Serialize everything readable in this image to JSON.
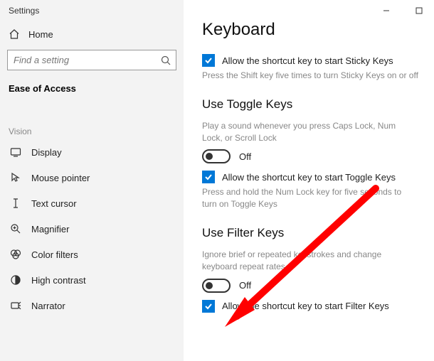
{
  "app": {
    "title": "Settings"
  },
  "sidebar": {
    "home_label": "Home",
    "search_placeholder": "Find a setting",
    "active_section": "Ease of Access",
    "group_head": "Vision",
    "items": [
      {
        "label": "Display"
      },
      {
        "label": "Mouse pointer"
      },
      {
        "label": "Text cursor"
      },
      {
        "label": "Magnifier"
      },
      {
        "label": "Color filters"
      },
      {
        "label": "High contrast"
      },
      {
        "label": "Narrator"
      }
    ]
  },
  "main": {
    "page_title": "Keyboard",
    "sticky": {
      "checkbox_label": "Allow the shortcut key to start Sticky Keys",
      "desc": "Press the Shift key five times to turn Sticky Keys on or off"
    },
    "toggle_section": {
      "heading": "Use Toggle Keys",
      "desc": "Play a sound whenever you press Caps Lock, Num Lock, or Scroll Lock",
      "toggle_state": "Off",
      "checkbox_label": "Allow the shortcut key to start Toggle Keys",
      "desc2": "Press and hold the Num Lock key for five seconds to turn on Toggle Keys"
    },
    "filter_section": {
      "heading": "Use Filter Keys",
      "desc": "Ignore brief or repeated keystrokes and change keyboard repeat rates",
      "toggle_state": "Off",
      "checkbox_label": "Allow the shortcut key to start Filter Keys"
    }
  }
}
